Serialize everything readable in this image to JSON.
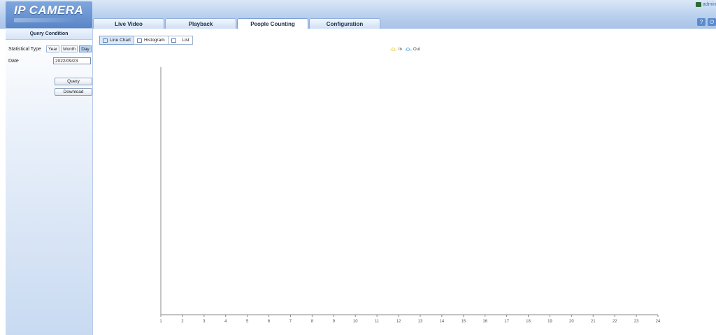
{
  "app": {
    "logo_text": "IP CAMERA",
    "user": "admin"
  },
  "tabs": [
    "Live Video",
    "Playback",
    "People Counting",
    "Configuration"
  ],
  "active_tab": "People Counting",
  "sidebar": {
    "title": "Query Condition",
    "statistical_type_label": "Statistical Type",
    "statistical_types": [
      "Year",
      "Month",
      "Day"
    ],
    "selected_type": "Day",
    "date_label": "Date",
    "date_value": "2022/09/23",
    "query_button": "Query",
    "download_button": "Download"
  },
  "views": [
    "Line Chart",
    "Histogram",
    "List"
  ],
  "active_view": "Line Chart",
  "colors": {
    "in": "#f0d35a",
    "out": "#6ab8e8",
    "accent": "#5b86c7"
  },
  "chart_data": {
    "type": "line",
    "x": [
      1,
      2,
      3,
      4,
      5,
      6,
      7,
      8,
      9,
      10,
      11,
      12,
      13,
      14,
      15,
      16,
      17,
      18,
      19,
      20,
      21,
      22,
      23,
      24
    ],
    "series": [
      {
        "name": "In",
        "values": []
      },
      {
        "name": "Out",
        "values": []
      }
    ],
    "xlim": [
      1,
      24
    ],
    "grid": false,
    "legend": "top-center"
  }
}
